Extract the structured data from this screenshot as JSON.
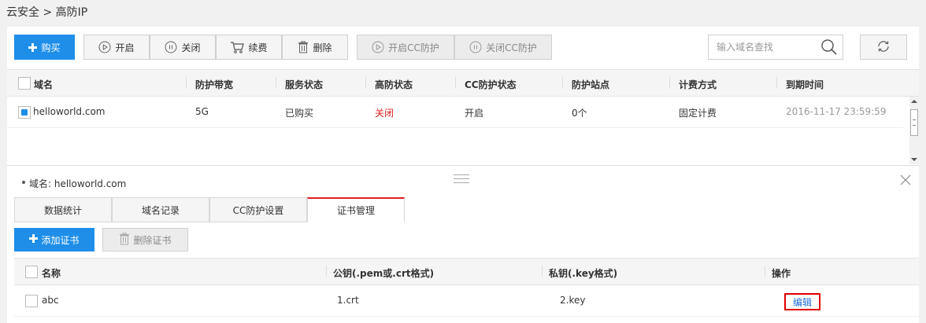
{
  "breadcrumb": "云安全 > 高防IP",
  "toolbar": {
    "buy": "购买",
    "start": "开启",
    "close": "关闭",
    "renew": "续费",
    "delete": "删除",
    "cc_on": "开启CC防护",
    "cc_off": "关闭CC防护"
  },
  "search": {
    "placeholder": "输入域名查找"
  },
  "table": {
    "headers": [
      "域名",
      "防护带宽",
      "服务状态",
      "高防状态",
      "CC防护状态",
      "防护站点",
      "计费方式",
      "到期时间"
    ],
    "rows": [
      {
        "domain": "helloworld.com",
        "bandwidth": "5G",
        "service_status": "已购买",
        "ddos_status": "关闭",
        "cc_status": "开启",
        "sites": "0个",
        "billing": "固定计费",
        "expiry": "2016-11-17 23:59:59"
      }
    ]
  },
  "detail": {
    "domain_label": "域名: helloworld.com",
    "tabs": [
      "数据统计",
      "域名记录",
      "CC防护设置",
      "证书管理"
    ],
    "active_tab": 3,
    "add_cert": "添加证书",
    "delete_cert": "删除证书",
    "cert_headers": [
      "名称",
      "公钥(.pem或.crt格式)",
      "私钥(.key格式)",
      "操作"
    ],
    "cert_rows": [
      {
        "name": "abc",
        "public_key": "1.crt",
        "private_key": "2.key",
        "action": "编辑"
      }
    ]
  },
  "colors": {
    "primary": "#1e8ee9",
    "danger": "#e02020",
    "link": "#1e6fd9"
  }
}
